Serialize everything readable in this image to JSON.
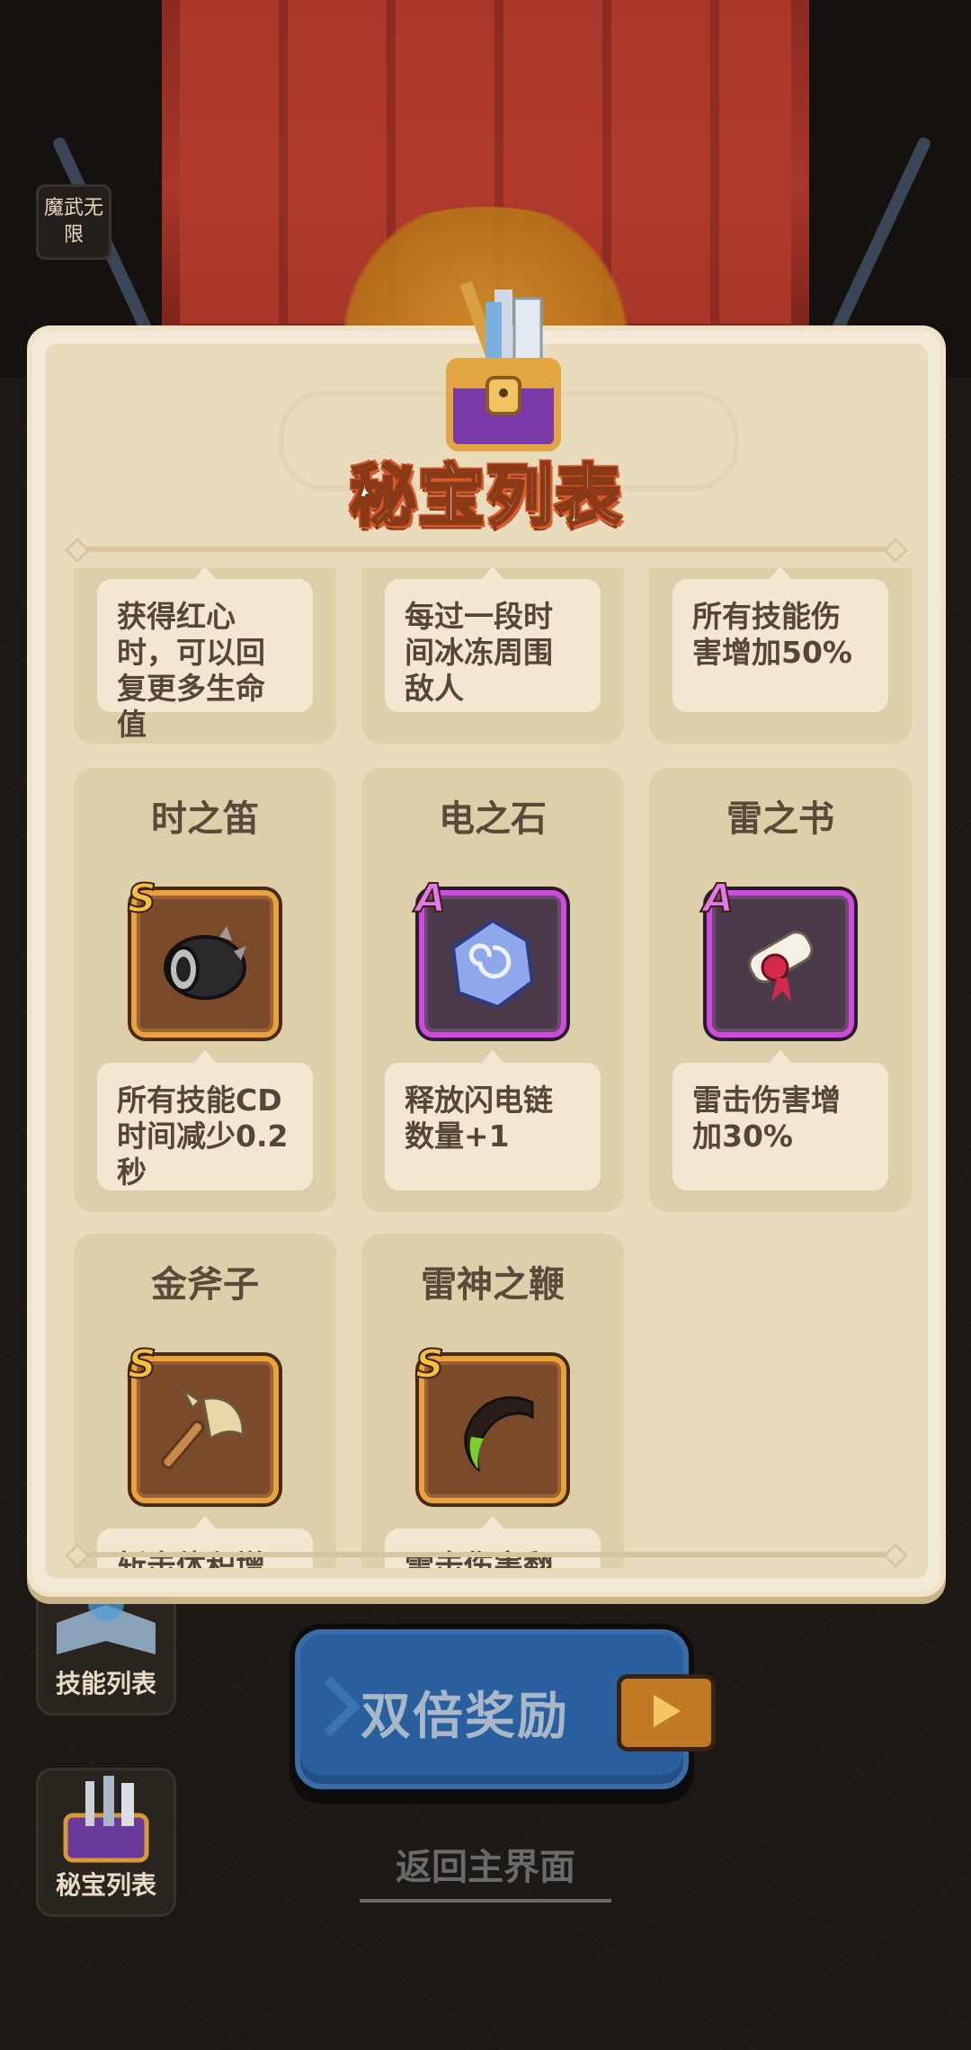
{
  "background": {
    "emblem_text": "魔武无限"
  },
  "modal": {
    "title": "秘宝列表"
  },
  "treasures_top_row_partial": [
    {
      "description": "获得红心时，可以回复更多生命值"
    },
    {
      "description": "每过一段时间冰冻周围敌人"
    },
    {
      "description": "所有技能伤害增加50%"
    }
  ],
  "treasures": [
    {
      "name": "时之笛",
      "rank": "S",
      "description": "所有技能CD时间减少0.2秒",
      "icon": "black-cannon-flute-icon"
    },
    {
      "name": "电之石",
      "rank": "A",
      "description": "释放闪电链数量+1",
      "icon": "blue-rune-stone-icon"
    },
    {
      "name": "雷之书",
      "rank": "A",
      "description": "雷击伤害增加30%",
      "icon": "scroll-with-seal-icon"
    },
    {
      "name": "金斧子",
      "rank": "S",
      "description": "斩击体积增大",
      "icon": "golden-axe-icon"
    },
    {
      "name": "雷神之鞭",
      "rank": "S",
      "description": "雷击伤害翻倍",
      "icon": "horn-whip-icon"
    }
  ],
  "side_buttons": {
    "skills_label": "技能列表",
    "treasures_label": "秘宝列表"
  },
  "actions": {
    "double_reward_label": "双倍奖励",
    "back_label": "返回主界面"
  },
  "colors": {
    "rank_s": "#e8a33a",
    "rank_a": "#cf4bdc",
    "modal_bg": "#e8dcbd",
    "title_orange": "#d65a2c",
    "double_button": "#2a5f9e"
  }
}
